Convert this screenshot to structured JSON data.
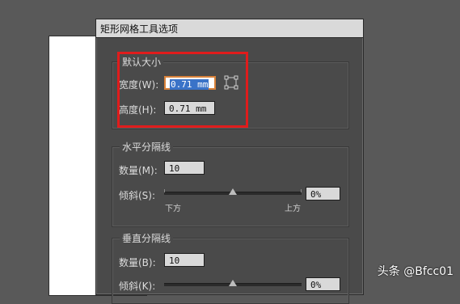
{
  "dialog": {
    "title": "矩形网格工具选项",
    "default_size": {
      "title": "默认大小",
      "width_label": "宽度(W):",
      "width_value": "0.71 mm",
      "height_label": "高度(H):",
      "height_value": "0.71 mm"
    },
    "horizontal": {
      "title": "水平分隔线",
      "count_label": "数量(M):",
      "count_value": "10",
      "skew_label": "倾斜(S):",
      "skew_value": "0%",
      "min_label": "下方",
      "max_label": "上方"
    },
    "vertical": {
      "title": "垂直分隔线",
      "count_label": "数量(B):",
      "count_value": "10",
      "skew_label": "倾斜(K):",
      "skew_value": "0%"
    }
  },
  "watermark": "头条 @Bfcc01"
}
